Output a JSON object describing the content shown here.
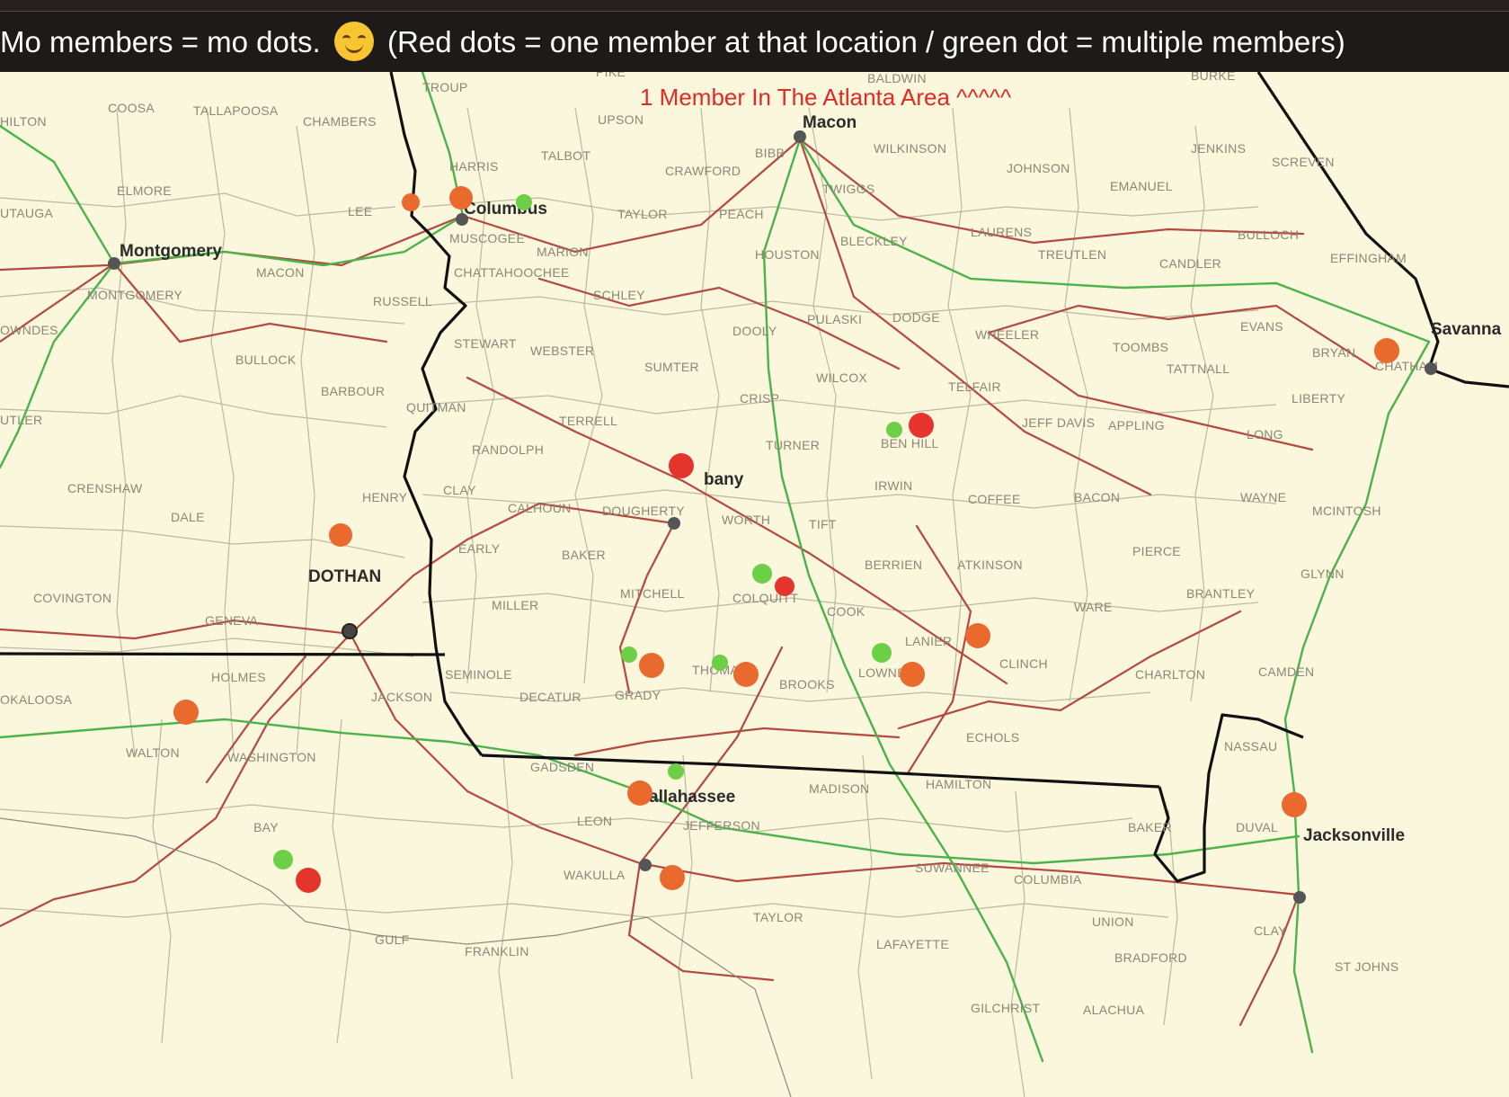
{
  "caption": {
    "text_before": "Mo members = mo dots.",
    "emoji": "smiling-face-icon",
    "text_after": "(Red dots = one member at that location / green dot = multiple members)"
  },
  "annotation": "1 Member In The Atlanta Area ^^^^^",
  "colors": {
    "background": "#faf7dd",
    "county_lines": "#b9b59c",
    "roads": "#b5483f",
    "interstates": "#4cb34a",
    "state_line": "#111111",
    "red_dot": "#e5342c",
    "orange_dot": "#ea6a2e",
    "green_dot": "#6ccf46",
    "annotation": "#e22a24"
  },
  "cities": [
    {
      "name": "Montgomery"
    },
    {
      "name": "Columbus"
    },
    {
      "name": "Macon"
    },
    {
      "name": "Albany",
      "shown": "bany"
    },
    {
      "name": "DOTHAN"
    },
    {
      "name": "Tallahassee",
      "shown": "allahassee"
    },
    {
      "name": "Jacksonville"
    },
    {
      "name": "Savanna"
    }
  ],
  "counties": [
    "COOSA",
    "TALLAPOOSA",
    "CHAMBERS",
    "TROUP",
    "PIKE",
    "BALDWIN",
    "BURKE",
    "HILTON",
    "UPSON",
    "WILKINSON",
    "JENKINS",
    "SCREVEN",
    "ELMORE",
    "HARRIS",
    "TALBOT",
    "CRAWFORD",
    "BIBB",
    "JOHNSON",
    "EMANUEL",
    "UTAUGA",
    "LEE",
    "TAYLOR",
    "PEACH",
    "TWIGGS",
    "LAURENS",
    "BULLOCH",
    "MUSCOGEE",
    "MARION",
    "BLECKLEY",
    "MACON",
    "CHATTAHOOCHEE",
    "HOUSTON",
    "TREUTLEN",
    "CANDLER",
    "EFFINGHAM",
    "MONTGOMERY",
    "RUSSELL",
    "SCHLEY",
    "DOOLY",
    "PULASKI",
    "DODGE",
    "EVANS",
    "OWNDES",
    "STEWART",
    "WEBSTER",
    "WHEELER",
    "TOOMBS",
    "BRYAN",
    "BULLOCK",
    "SUMTER",
    "WILCOX",
    "TATTNALL",
    "CHATHAM",
    "BARBOUR",
    "CRISP",
    "TELFAIR",
    "LIBERTY",
    "QUITMAN",
    "TERRELL",
    "JEFF DAVIS",
    "APPLING",
    "UTLER",
    "BEN HILL",
    "TURNER",
    "LONG",
    "RANDOLPH",
    "CRENSHAW",
    "HENRY",
    "CLAY",
    "IRWIN",
    "COFFEE",
    "BACON",
    "WAYNE",
    "CALHOUN",
    "DOUGHERTY",
    "WORTH",
    "TIFT",
    "MCINTOSH",
    "DALE",
    "EARLY",
    "BAKER",
    "PIERCE",
    "BERRIEN",
    "ATKINSON",
    "GLYNN",
    "MITCHELL",
    "COLQUITT",
    "BRANTLEY",
    "COVINGTON",
    "MILLER",
    "COOK",
    "WARE",
    "GENEVA",
    "LANIER",
    "HOLMES",
    "SEMINOLE",
    "THOMAS",
    "LOWNDES",
    "CLINCH",
    "CHARLTON",
    "CAMDEN",
    "OKALOOSA",
    "JACKSON",
    "DECATUR",
    "GRADY",
    "BROOKS",
    "ECHOLS",
    "WALTON",
    "WASHINGTON",
    "NASSAU",
    "GADSDEN",
    "MADISON",
    "HAMILTON",
    "LEON",
    "JEFFERSON",
    "BAY",
    "DUVAL",
    "BAKER",
    "SUWANNEE",
    "COLUMBIA",
    "UNION",
    "WAKULLA",
    "TAYLOR",
    "CLAY",
    "GULF",
    "FRANKLIN",
    "LAFAYETTE",
    "BRADFORD",
    "ST JOHNS",
    "GILCHRIST",
    "ALACHUA"
  ],
  "markers": [
    {
      "label": "multiple-members",
      "color": "green",
      "count": 10
    },
    {
      "label": "one-member",
      "color": "red/orange",
      "count": 18
    }
  ]
}
